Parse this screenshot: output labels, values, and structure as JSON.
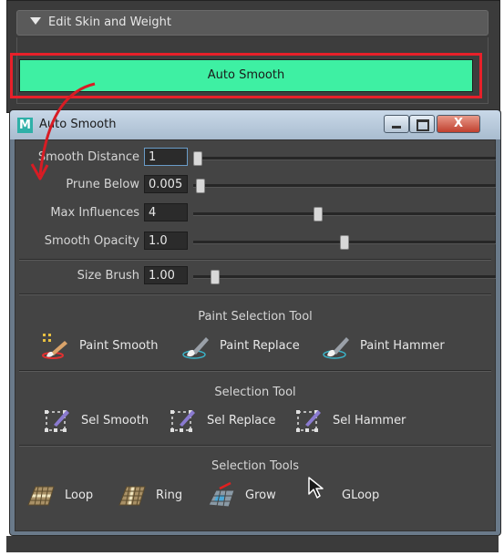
{
  "panel": {
    "frame_title": "Edit Skin and Weight",
    "auto_smooth_label": "Auto Smooth"
  },
  "window": {
    "logo": "M",
    "title": "Auto Smooth",
    "close_glyph": "X"
  },
  "sliders": [
    {
      "label": "Smooth Distance",
      "value": "1",
      "fraction": 0.0
    },
    {
      "label": "Prune Below",
      "value": "0.005",
      "fraction": 0.01
    },
    {
      "label": "Max Influences",
      "value": "4",
      "fraction": 0.41
    },
    {
      "label": "Smooth Opacity",
      "value": "1.0",
      "fraction": 0.5
    }
  ],
  "brush": {
    "label": "Size Brush",
    "value": "1.00",
    "fraction": 0.06
  },
  "paint_selection": {
    "title": "Paint Selection Tool",
    "tools": [
      {
        "label": "Paint Smooth",
        "icon": "paint-smooth-icon"
      },
      {
        "label": "Paint Replace",
        "icon": "paint-brush-icon"
      },
      {
        "label": "Paint Hammer",
        "icon": "paint-brush-icon"
      }
    ]
  },
  "selection_tool": {
    "title": "Selection Tool",
    "tools": [
      {
        "label": "Sel Smooth",
        "icon": "selection-brush-icon"
      },
      {
        "label": "Sel Replace",
        "icon": "selection-brush-icon"
      },
      {
        "label": "Sel Hammer",
        "icon": "selection-brush-icon"
      }
    ]
  },
  "selection_tools": {
    "title": "Selection Tools",
    "tools": [
      {
        "label": "Loop",
        "icon": "loop-icon"
      },
      {
        "label": "Ring",
        "icon": "ring-icon"
      },
      {
        "label": "Grow",
        "icon": "grow-icon"
      },
      {
        "label": "GLoop",
        "icon": "cursor-icon"
      }
    ]
  },
  "colors": {
    "accent_button": "#3ef0a3",
    "highlight_border": "#e8202a",
    "window_bg": "#444444"
  }
}
